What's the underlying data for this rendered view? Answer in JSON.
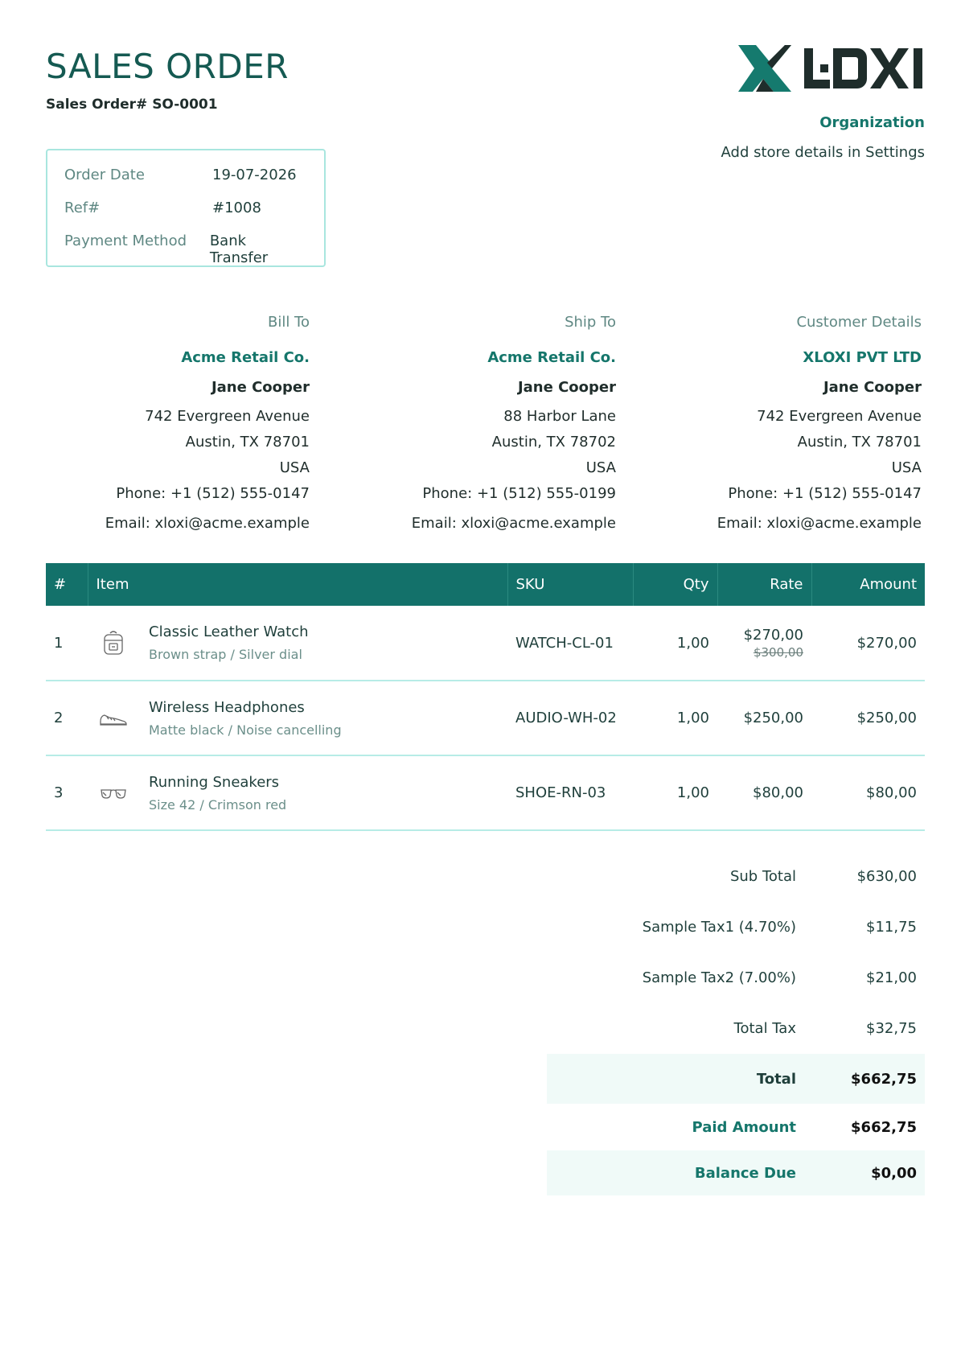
{
  "document": {
    "title": "SALES ORDER",
    "order_number_label": "Sales Order# SO-0001"
  },
  "brand": {
    "logo_text": "XLOXI",
    "logo_icon": "xloxi-logo-icon",
    "accent_color": "#15766b",
    "dark_color": "#1f2d2b"
  },
  "organization": {
    "heading": "Organization",
    "subtext": "Add store details in Settings"
  },
  "meta": [
    {
      "label": "Order Date",
      "value": "19-07-2026"
    },
    {
      "label": "Ref#",
      "value": "#1008"
    },
    {
      "label": "Payment Method",
      "value": "Bank Transfer"
    }
  ],
  "addresses": {
    "bill_to": {
      "heading": "Bill To",
      "company": "Acme Retail Co.",
      "person": "Jane Cooper",
      "street": "742 Evergreen Avenue",
      "city": "Austin, TX 78701",
      "country": "USA",
      "phone": "Phone: +1 (512) 555-0147",
      "email": "Email: xloxi@acme.example"
    },
    "ship_to": {
      "heading": "Ship To",
      "company": "Acme Retail Co.",
      "person": "Jane Cooper",
      "street": "88 Harbor Lane",
      "city": "Austin, TX 78702",
      "country": "USA",
      "phone": "Phone: +1 (512) 555-0199",
      "email": "Email: xloxi@acme.example"
    },
    "customer": {
      "heading": "Customer Details",
      "company": "XLOXI PVT LTD",
      "person": "Jane Cooper",
      "street": "742 Evergreen Avenue",
      "city": "Austin, TX 78701",
      "country": "USA",
      "phone": "Phone: +1 (512) 555-0147",
      "email": "Email: xloxi@acme.example"
    }
  },
  "table": {
    "headers": {
      "idx": "#",
      "item": "Item",
      "sku": "SKU",
      "qty": "Qty",
      "rate": "Rate",
      "amount": "Amount"
    },
    "rows": [
      {
        "idx": "1",
        "icon": "backpack-icon",
        "name": "Classic Leather Watch",
        "desc": "Brown strap / Silver dial",
        "sku": "WATCH-CL-01",
        "qty": "1,00",
        "rate": "$270,00",
        "rate_old": "$300,00",
        "amount": "$270,00"
      },
      {
        "idx": "2",
        "icon": "sneaker-icon",
        "name": "Wireless Headphones",
        "desc": "Matte black / Noise cancelling",
        "sku": "AUDIO-WH-02",
        "qty": "1,00",
        "rate": "$250,00",
        "rate_old": "",
        "amount": "$250,00"
      },
      {
        "idx": "3",
        "icon": "glasses-icon",
        "name": "Running Sneakers",
        "desc": "Size 42 / Crimson red",
        "sku": "SHOE-RN-03",
        "qty": "1,00",
        "rate": "$80,00",
        "rate_old": "",
        "amount": "$80,00"
      }
    ]
  },
  "totals": {
    "sub_total": {
      "label": "Sub Total",
      "value": "$630,00"
    },
    "tax1": {
      "label": "Sample Tax1 (4.70%)",
      "value": "$11,75"
    },
    "tax2": {
      "label": "Sample Tax2 (7.00%)",
      "value": "$21,00"
    },
    "total_tax": {
      "label": "Total Tax",
      "value": "$32,75"
    },
    "total": {
      "label": "Total",
      "value": "$662,75"
    },
    "paid": {
      "label": "Paid Amount",
      "value": "$662,75"
    },
    "balance": {
      "label": "Balance Due",
      "value": "$0,00"
    }
  }
}
